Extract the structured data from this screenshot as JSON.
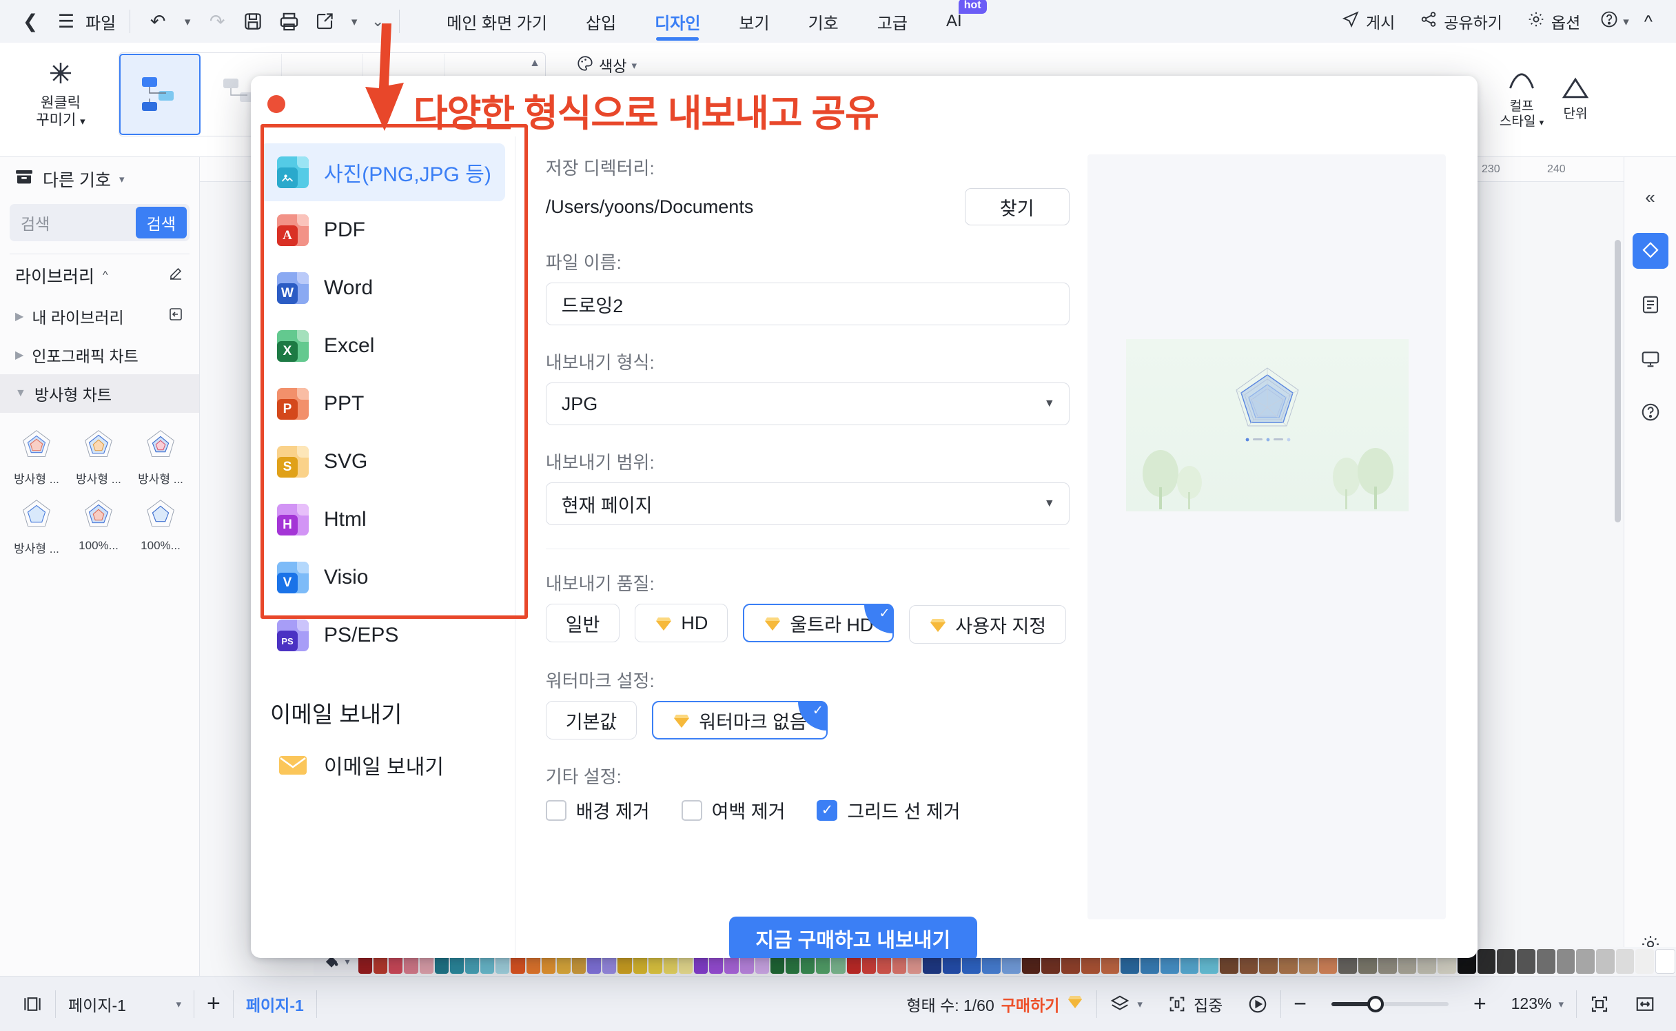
{
  "topbar": {
    "back_icon": "chevron-left-icon",
    "file_menu_icon": "hamburger-icon",
    "file_label": "파일",
    "undo_icon": "undo-icon",
    "redo_icon": "redo-icon",
    "save_icon": "save-icon",
    "print_icon": "print-icon",
    "export_icon": "export-share-icon",
    "more_icon": "chevron-down-icon",
    "menu_items": [
      {
        "label": "메인 화면 가기",
        "active": false
      },
      {
        "label": "삽입",
        "active": false
      },
      {
        "label": "디자인",
        "active": true
      },
      {
        "label": "보기",
        "active": false
      },
      {
        "label": "기호",
        "active": false
      },
      {
        "label": "고급",
        "active": false
      },
      {
        "label": "AI",
        "active": false,
        "badge": "hot"
      }
    ],
    "right_items": [
      {
        "label": "게시",
        "icon": "publish-icon"
      },
      {
        "label": "공유하기",
        "icon": "share-nodes-icon"
      },
      {
        "label": "옵션",
        "icon": "gear-icon"
      },
      {
        "label": "",
        "icon": "help-circle-icon"
      },
      {
        "label": "",
        "icon": "chevron-up-icon"
      }
    ]
  },
  "ribbon": {
    "oneclick_label": "원클릭\n꾸미기",
    "oneclick_icon": "sparkle-icon",
    "color_label": "색상",
    "tool_icons": [
      "theme-fill-icon",
      "line-style-icon",
      "text-style-icon",
      "text-box-icon",
      "layout-icon",
      "frame-icon",
      "align-icon",
      "font-size-icon"
    ],
    "right_groups": [
      {
        "label": "컬프\n스타일",
        "icon": "curve-style-icon"
      },
      {
        "label": "단위",
        "icon": "triangle-unit-icon"
      }
    ]
  },
  "leftpanel": {
    "header_label": "다른 기호",
    "header_icon": "library-box-icon",
    "search_placeholder": "검색",
    "search_button": "검색",
    "section_label": "라이브러리",
    "section_icon": "chevron-up-icon",
    "rows": [
      {
        "label": "내 라이브러리",
        "expanded": false,
        "selected": false
      },
      {
        "label": "인포그래픽 차트",
        "expanded": false,
        "selected": false
      },
      {
        "label": "방사형 차트",
        "expanded": true,
        "selected": true
      }
    ],
    "thumbnails": [
      {
        "caption": "방사형 ..."
      },
      {
        "caption": "방사형 ..."
      },
      {
        "caption": "방사형 ..."
      },
      {
        "caption": "방사형 ..."
      },
      {
        "caption": "100%..."
      },
      {
        "caption": "100%..."
      }
    ]
  },
  "canvas": {
    "ruler_ticks": [
      "230",
      "240"
    ]
  },
  "rightrail": {
    "buttons": [
      {
        "icon": "fill-style-icon",
        "selected": true
      },
      {
        "icon": "page-layout-icon",
        "selected": false
      },
      {
        "icon": "presentation-icon",
        "selected": false
      },
      {
        "icon": "help-circle-icon",
        "selected": false
      }
    ],
    "collapse_icon": "chevron-double-left-icon",
    "gear_icon": "gear-icon"
  },
  "bottombar": {
    "view_icon": "page-view-icon",
    "page_select": "페이지-1",
    "add_page_icon": "plus-icon",
    "page_tab": "페이지-1",
    "shape_count_label": "형태 수: 1/60",
    "buy_label": "구매하기",
    "buy_icon": "diamond-icon",
    "layers_icon": "layers-icon",
    "focus_label": "집중",
    "focus_icon": "focus-frame-icon",
    "play_icon": "play-circle-icon",
    "zoom_out_icon": "minus-icon",
    "zoom_in_icon": "plus-icon",
    "zoom_level": "123%",
    "zoom_caret_icon": "chevron-down-icon",
    "fit_icon": "fit-page-icon",
    "fit_width_icon": "fit-width-icon",
    "fill_icon": "paint-bucket-icon"
  },
  "annotation": {
    "text": "다양한 형식으로 내보내고 공유",
    "color": "#e8472a"
  },
  "dialog": {
    "close_icon": "close-traffic-light",
    "formats": [
      {
        "label": "사진(PNG,JPG 등)",
        "icon": "image-file-icon",
        "tag": "",
        "color": "#3fc3e0",
        "fold": "#8fe0f2",
        "tagcolor": "#2aa9cc",
        "selected": true
      },
      {
        "label": "PDF",
        "icon": "pdf-file-icon",
        "tag": "A",
        "color": "#f08a7c",
        "fold": "#f8bdb3",
        "tagcolor": "#d93025",
        "selected": false
      },
      {
        "label": "Word",
        "icon": "word-file-icon",
        "tag": "W",
        "color": "#7a9cf0",
        "fold": "#aec2f7",
        "tagcolor": "#2b5cc4",
        "selected": false
      },
      {
        "label": "Excel",
        "icon": "excel-file-icon",
        "tag": "X",
        "color": "#62c68c",
        "fold": "#9fdcba",
        "tagcolor": "#1d7a44",
        "selected": false
      },
      {
        "label": "PPT",
        "icon": "ppt-file-icon",
        "tag": "P",
        "color": "#f08a63",
        "fold": "#f7b79c",
        "tagcolor": "#d4481b",
        "selected": false
      },
      {
        "label": "SVG",
        "icon": "svg-file-icon",
        "tag": "S",
        "color": "#f7cb7a",
        "fold": "#fbe0ae",
        "tagcolor": "#e0a119",
        "selected": false
      },
      {
        "label": "Html",
        "icon": "html-file-icon",
        "tag": "H",
        "color": "#cf8cf0",
        "fold": "#e3b7f7",
        "tagcolor": "#a435d6",
        "selected": false
      },
      {
        "label": "Visio",
        "icon": "visio-file-icon",
        "tag": "V",
        "color": "#7ab6f5",
        "fold": "#b0d5fa",
        "tagcolor": "#1a73e8",
        "selected": false
      },
      {
        "label": "PS/EPS",
        "icon": "ps-eps-file-icon",
        "tag": "PS",
        "color": "#a79bf5",
        "fold": "#c9c1fa",
        "tagcolor": "#4b32c3",
        "selected": false
      }
    ],
    "email_section_title": "이메일 보내기",
    "email_item_label": "이메일 보내기",
    "email_item_icon": "envelope-icon",
    "fields": {
      "save_dir_label": "저장 디렉터리:",
      "save_dir_value": "/Users/yoons/Documents",
      "browse_button": "찾기",
      "file_name_label": "파일 이름:",
      "file_name_value": "드로잉2",
      "export_format_label": "내보내기 형식:",
      "export_format_value": "JPG",
      "export_range_label": "내보내기 범위:",
      "export_range_value": "현재 페이지",
      "export_quality_label": "내보내기 품질:",
      "quality_options": [
        {
          "label": "일반",
          "premium": false,
          "selected": false
        },
        {
          "label": "HD",
          "premium": true,
          "selected": false
        },
        {
          "label": "울트라 HD",
          "premium": true,
          "selected": true
        },
        {
          "label": "사용자 지정",
          "premium": true,
          "selected": false
        }
      ],
      "watermark_label": "워터마크 설정:",
      "watermark_options": [
        {
          "label": "기본값",
          "premium": false,
          "selected": false
        },
        {
          "label": "워터마크 없음",
          "premium": true,
          "selected": true
        }
      ],
      "other_label": "기타 설정:",
      "other_options": [
        {
          "label": "배경 제거",
          "checked": false
        },
        {
          "label": "여백 제거",
          "checked": false
        },
        {
          "label": "그리드 선 제거",
          "checked": true
        }
      ],
      "primary_button": "지금 구매하고 내보내기"
    }
  },
  "colors": {
    "accent": "#3b7ff5",
    "annotation_red": "#e8472a",
    "premium_gold": "#f6b93b",
    "buy_orange": "#f0512a"
  }
}
